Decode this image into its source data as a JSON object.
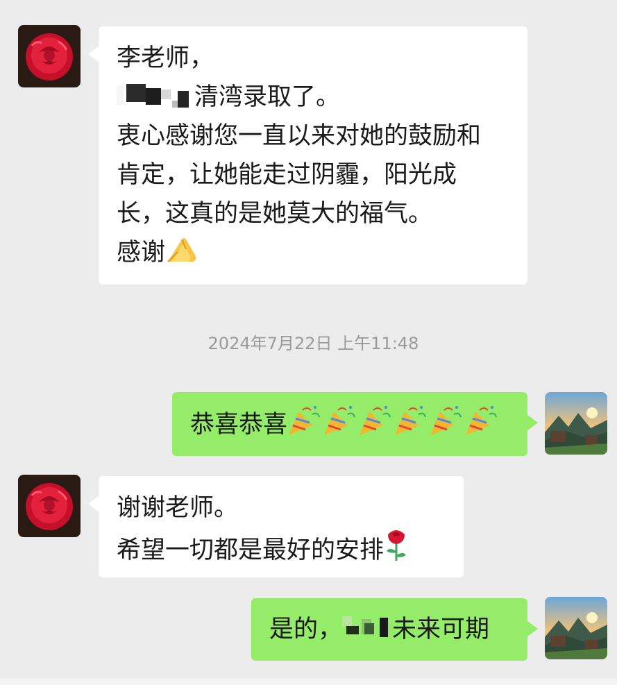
{
  "timestamp": "2024年7月22日 上午11:48",
  "messages": [
    {
      "side": "in",
      "avatar": "red-rose-avatar",
      "lines": [
        "李老师，",
        "清湾录取了。",
        "衷心感谢您一直以来对她的鼓励和",
        "肯定，让她能走过阴霾，阳光成",
        "长，这真的是她莫大的福气。",
        "感谢"
      ],
      "redacted_segments": 1,
      "trailing_emoji": "folded-hands-emoji"
    },
    {
      "side": "out",
      "avatar": "mountain-sunrise-avatar",
      "text": "恭喜恭喜",
      "trailing_emoji": "party-popper-emoji",
      "emoji_count": 6
    },
    {
      "side": "in",
      "avatar": "red-rose-avatar",
      "lines": [
        "谢谢老师。",
        "希望一切都是最好的安排"
      ],
      "trailing_emoji": "rose-emoji"
    },
    {
      "side": "out",
      "avatar": "mountain-sunrise-avatar",
      "prefix": "是的，",
      "suffix": "未来可期",
      "redacted_segments": 1
    }
  ],
  "colors": {
    "background": "#ececec",
    "incoming_bubble": "#ffffff",
    "outgoing_bubble": "#95ec69",
    "timestamp_text": "#9a9a9a"
  }
}
